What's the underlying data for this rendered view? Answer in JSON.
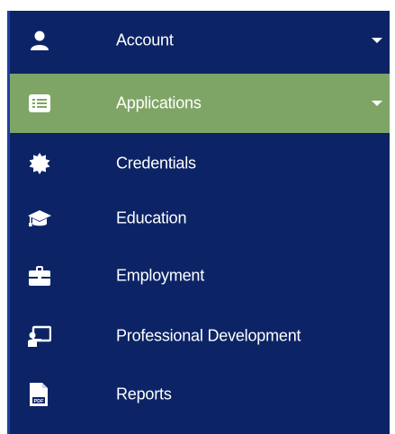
{
  "sidebar": {
    "items": [
      {
        "label": "Account",
        "icon": "user-icon",
        "has_dropdown": true,
        "active": false
      },
      {
        "label": "Applications",
        "icon": "list-card-icon",
        "has_dropdown": true,
        "active": true
      },
      {
        "label": "Credentials",
        "icon": "certificate-icon",
        "has_dropdown": false,
        "active": false
      },
      {
        "label": "Education",
        "icon": "graduation-cap-icon",
        "has_dropdown": false,
        "active": false
      },
      {
        "label": "Employment",
        "icon": "briefcase-icon",
        "has_dropdown": false,
        "active": false
      },
      {
        "label": "Professional Development",
        "icon": "presentation-icon",
        "has_dropdown": false,
        "active": false
      },
      {
        "label": "Reports",
        "icon": "pdf-file-icon",
        "has_dropdown": false,
        "active": false
      }
    ]
  },
  "colors": {
    "sidebar_background": "#0c2466",
    "active_background": "#7fa566",
    "text": "#ffffff",
    "active_icon_tint": "#7fa566"
  }
}
